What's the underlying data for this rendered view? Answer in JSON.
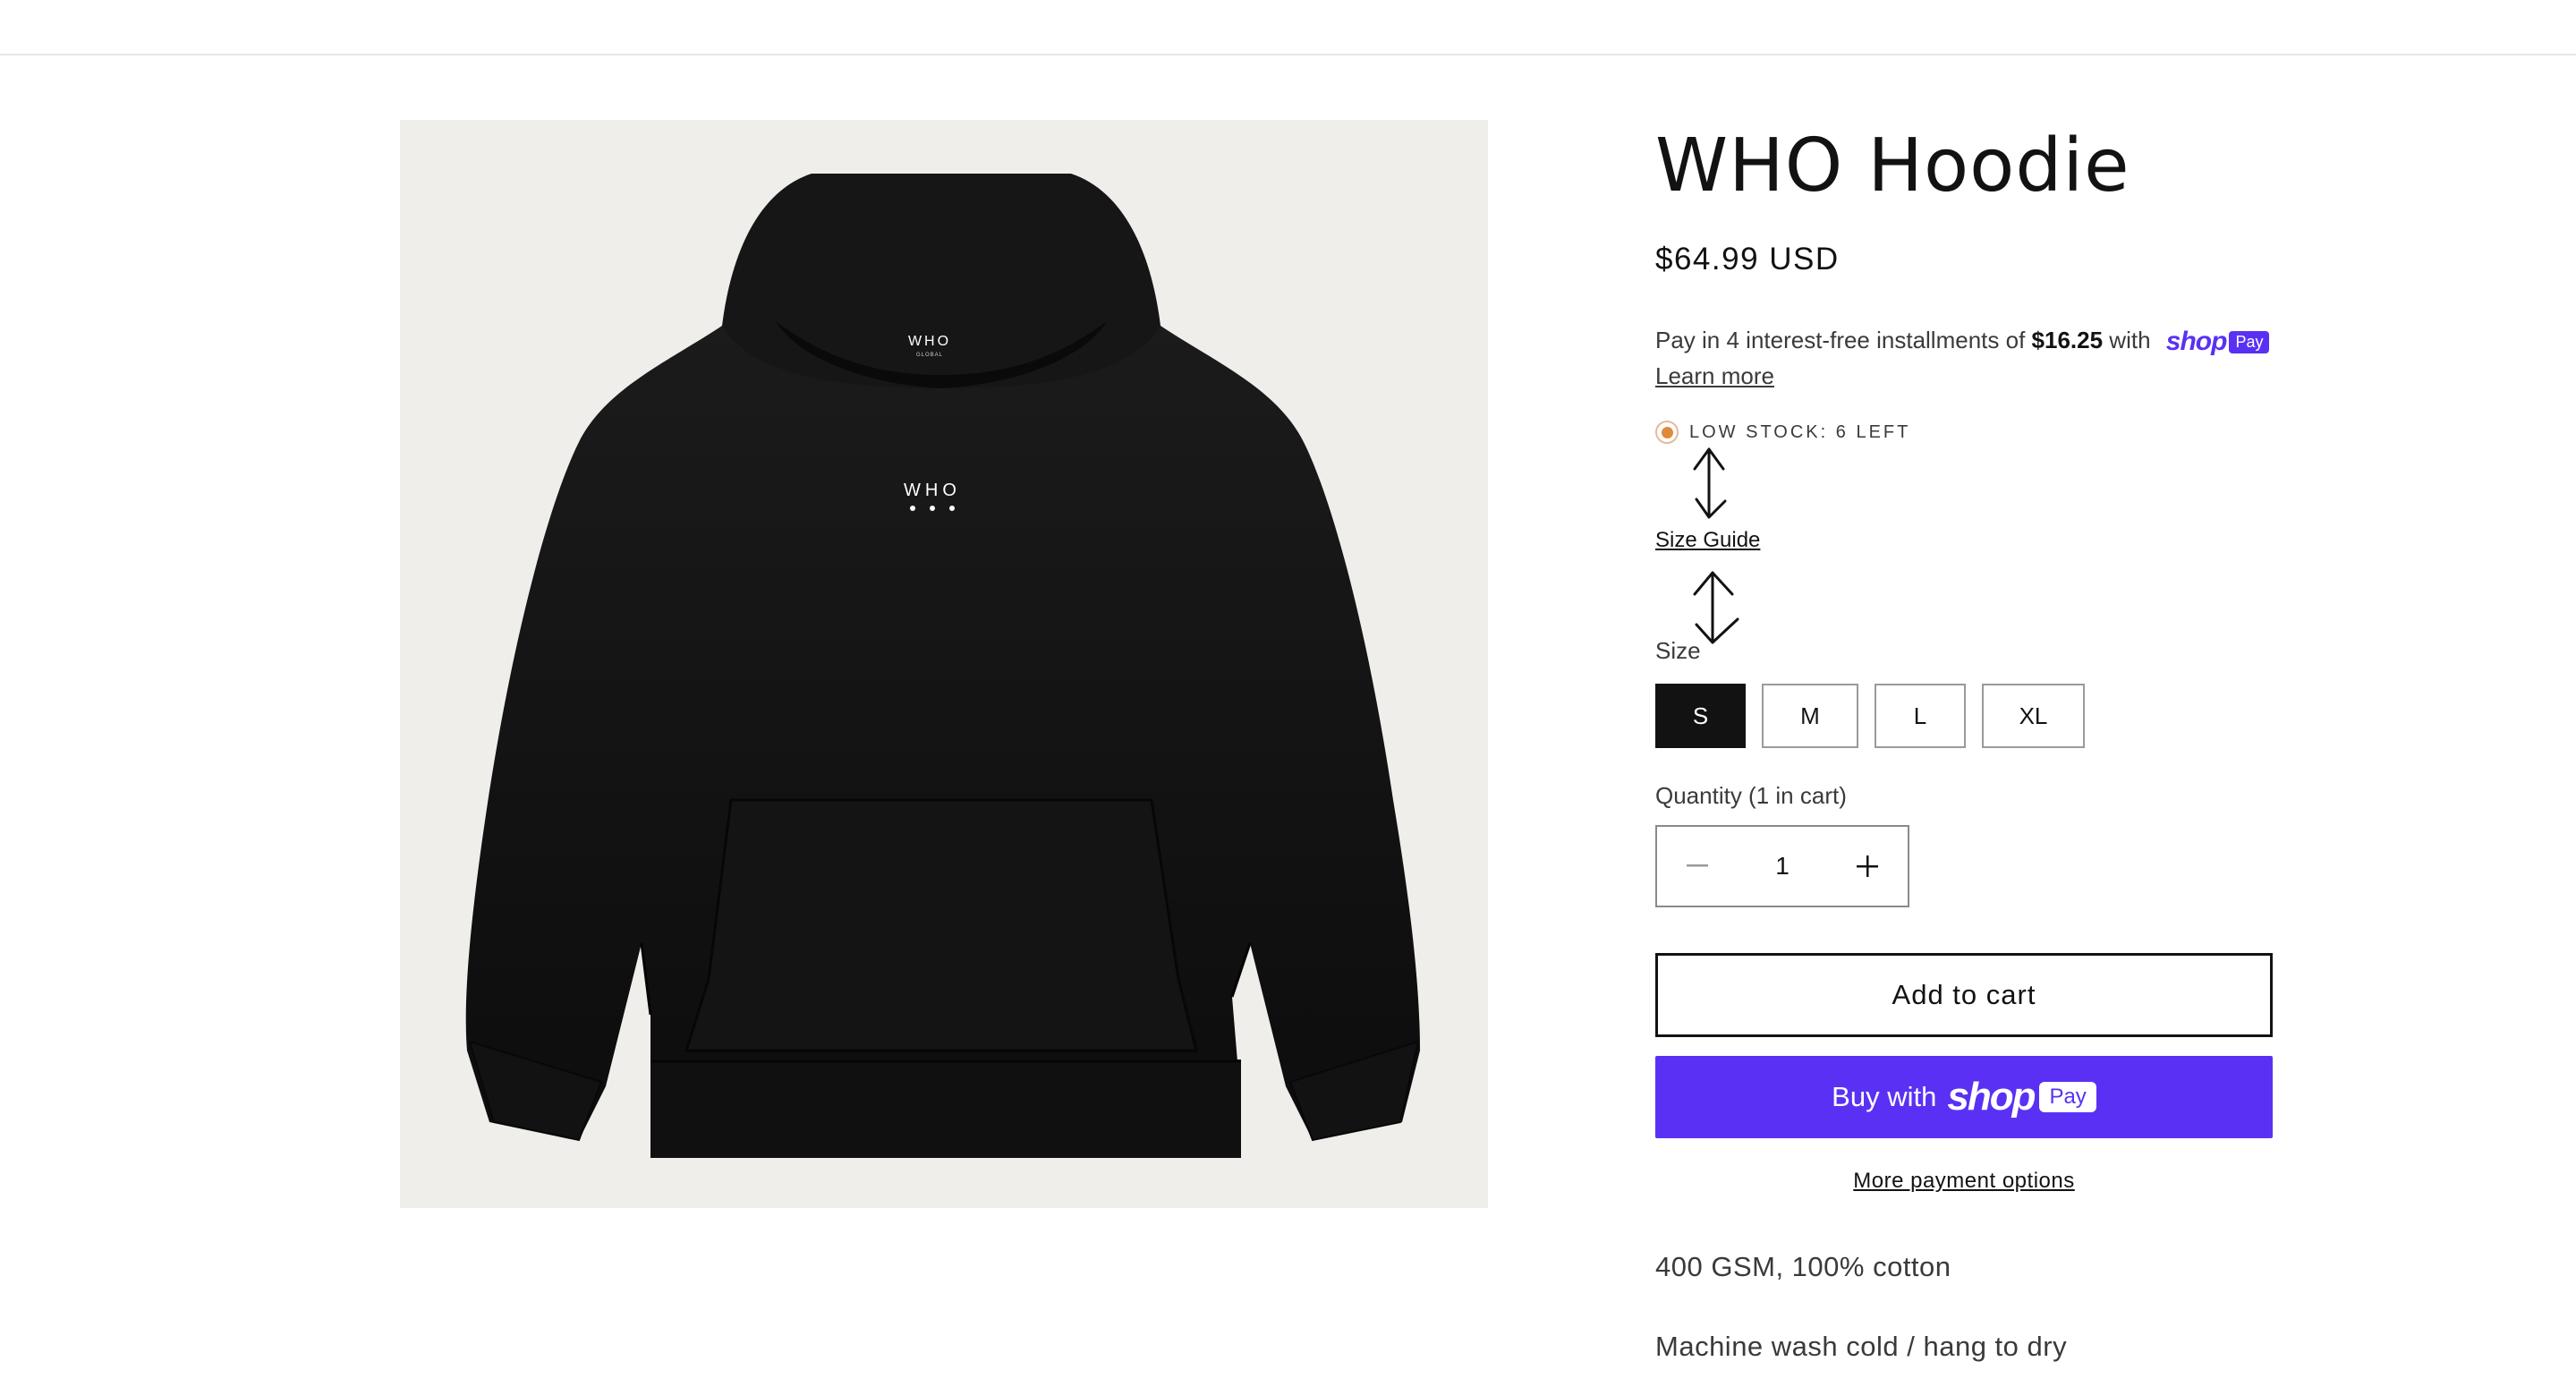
{
  "product": {
    "title": "WHO Hoodie",
    "price": "$64.99 USD",
    "image_print_chest": "WHO",
    "image_print_hood": "WHO",
    "image_print_hood_sub": "GLOBAL"
  },
  "installments": {
    "text_before": "Pay in 4 interest-free installments of ",
    "amount": "$16.25",
    "text_after": " with",
    "shop_word": "shop",
    "pay_word": "Pay",
    "learn_more": "Learn more"
  },
  "stock": {
    "label": "LOW STOCK: 6 LEFT",
    "status_color": "#e08a3c"
  },
  "size_guide": {
    "label": "Size Guide"
  },
  "size": {
    "label": "Size",
    "options": [
      "S",
      "M",
      "L",
      "XL"
    ],
    "selected": "S"
  },
  "quantity": {
    "label": "Quantity (1 in cart)",
    "value": "1",
    "minus_icon": "minus-icon",
    "plus_icon": "plus-icon"
  },
  "actions": {
    "add_to_cart": "Add to cart",
    "buy_with": "Buy with",
    "buy_shop_word": "shop",
    "buy_pay_word": "Pay",
    "more_payment": "More payment options"
  },
  "description": {
    "line1": "400 GSM, 100% cotton",
    "line2": "Machine wash cold / hang to dry"
  },
  "colors": {
    "brand_shop": "#5a31f4",
    "text": "#121212",
    "image_bg": "#efeeeb"
  }
}
